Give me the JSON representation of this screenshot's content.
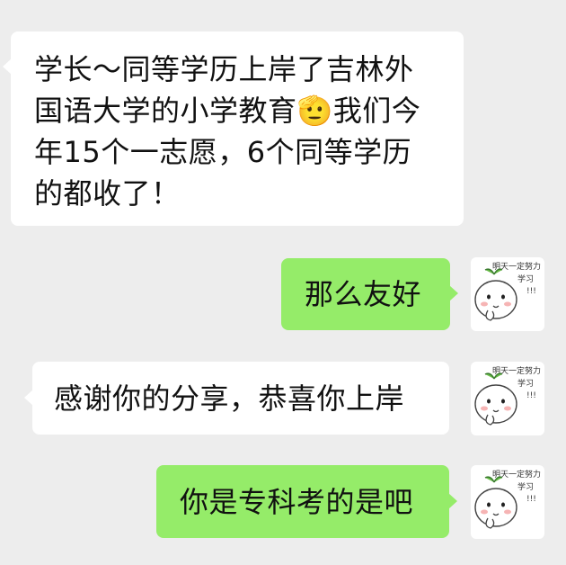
{
  "chat": {
    "messages": [
      {
        "sender": "other",
        "lines": [
          "学长～同等学历上岸了吉林外",
          "国语大学的小学教育🫡我们今",
          "年15个一志愿，6个同等学历",
          "的都收了！"
        ]
      },
      {
        "sender": "self",
        "text": "那么友好"
      },
      {
        "sender": "other",
        "text": "感谢你的分享，恭喜你上岸"
      },
      {
        "sender": "self",
        "text": "你是专科考的是吧"
      }
    ],
    "sticker_avatar": {
      "caption_line1": "明天一定努力",
      "caption_line2": "学习",
      "caption_line3": "!!!"
    }
  }
}
